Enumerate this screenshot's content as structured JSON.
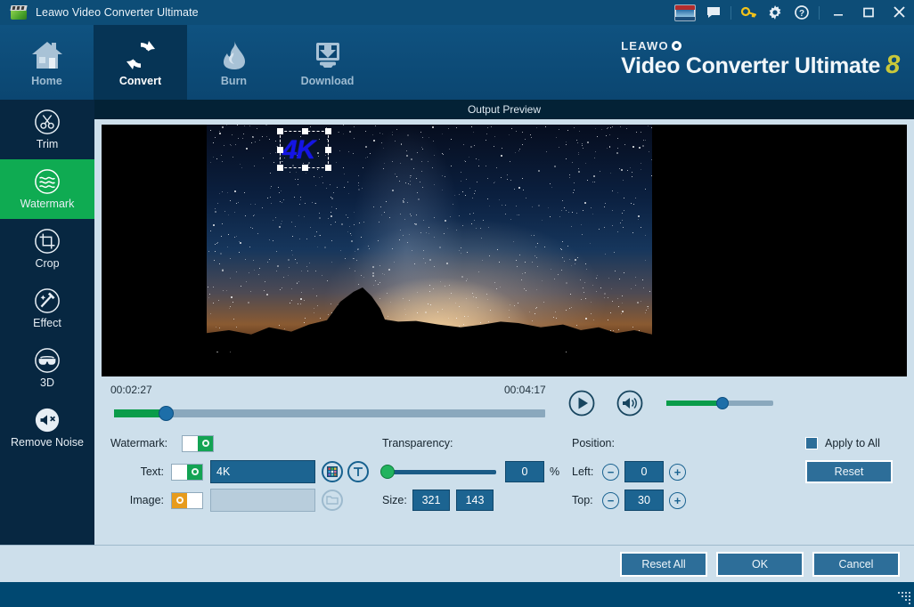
{
  "window": {
    "title": "Leawo Video Converter Ultimate",
    "app_icon": "clapperboard-icon",
    "titlebar_icons": [
      "product-badge-icon",
      "feedback-icon",
      "key-icon",
      "gear-icon",
      "help-icon"
    ],
    "minimize": "minimize-icon",
    "maximize": "maximize-icon",
    "close": "close-icon"
  },
  "mainnav": {
    "tabs": [
      {
        "label": "Home",
        "icon": "home-icon",
        "active": false
      },
      {
        "label": "Convert",
        "icon": "convert-icon",
        "active": true
      },
      {
        "label": "Burn",
        "icon": "flame-icon",
        "active": false
      },
      {
        "label": "Download",
        "icon": "download-monitor-icon",
        "active": false
      }
    ],
    "brand": {
      "top": "LEAWO",
      "main": "Video Converter Ultimate",
      "version": "8"
    }
  },
  "sidebar": {
    "items": [
      {
        "label": "Trim",
        "icon": "scissors-icon",
        "active": false
      },
      {
        "label": "Watermark",
        "icon": "wave-icon",
        "active": true
      },
      {
        "label": "Crop",
        "icon": "crop-icon",
        "active": false
      },
      {
        "label": "Effect",
        "icon": "magic-wand-icon",
        "active": false
      },
      {
        "label": "3D",
        "icon": "3d-glasses-icon",
        "active": false
      },
      {
        "label": "Remove Noise",
        "icon": "remove-noise-icon",
        "active": false
      }
    ]
  },
  "preview": {
    "header": "Output Preview",
    "watermark_text": "4K",
    "watermark_color": "#1414e6"
  },
  "transport": {
    "current_time": "00:02:27",
    "total_time": "00:04:17",
    "play_icon": "play-icon",
    "volume_icon": "volume-icon",
    "progress_percent": 12,
    "volume_percent": 50
  },
  "settings": {
    "watermark_label": "Watermark:",
    "watermark_enabled": "on",
    "text_label": "Text:",
    "text_enabled": "on",
    "text_value": "4K",
    "color_picker_icon": "color-palette-icon",
    "font_icon": "font-text-icon",
    "image_label": "Image:",
    "image_enabled": "off",
    "image_value": "",
    "image_browse_icon": "folder-open-icon",
    "transparency_label": "Transparency:",
    "transparency_value": "0",
    "transparency_unit": "%",
    "size_label": "Size:",
    "size_width": "321",
    "size_height": "143",
    "position_label": "Position:",
    "left_label": "Left:",
    "left_value": "0",
    "top_label": "Top:",
    "top_value": "30",
    "minus_icon": "minus-circle-icon",
    "plus_icon": "plus-circle-icon",
    "apply_to_all_label": "Apply to All",
    "apply_to_all_checked": false,
    "reset_label": "Reset"
  },
  "footer": {
    "reset_all_label": "Reset All",
    "ok_label": "OK",
    "cancel_label": "Cancel",
    "resize_grip": "resize-grip-icon"
  },
  "colors": {
    "titlebar": "#0d4d77",
    "nav": "#0b4671",
    "nav_active": "#063455",
    "sidebar": "#072741",
    "sidebar_active": "#0fab52",
    "panel": "#cddfeb",
    "accent_green": "#0a9c4a",
    "accent_blue": "#1d6ea8",
    "field_blue": "#1c6491",
    "brand_yellow": "#c9c83a"
  }
}
